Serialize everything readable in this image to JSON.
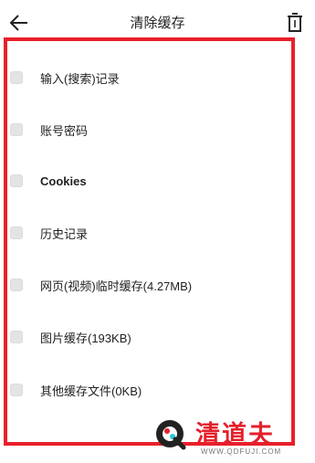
{
  "header": {
    "title": "清除缓存",
    "back_icon": "arrow-left-icon",
    "delete_icon": "trash-icon"
  },
  "colors": {
    "frame": "#e8202a",
    "checkbox": "#e4e4e4",
    "text": "#222222",
    "watermark_red": "#e4202b"
  },
  "items": [
    {
      "label": "输入(搜索)记录",
      "checked": false
    },
    {
      "label": "账号密码",
      "checked": false
    },
    {
      "label": "Cookies",
      "checked": false
    },
    {
      "label": "历史记录",
      "checked": false
    },
    {
      "label": "网页(视频)临时缓存(4.27MB)",
      "checked": false
    },
    {
      "label": "图片缓存(193KB)",
      "checked": false
    },
    {
      "label": "其他缓存文件(0KB)",
      "checked": false
    }
  ],
  "watermark": {
    "name": "清道夫",
    "url": "WWW.QDFUJI.COM"
  }
}
